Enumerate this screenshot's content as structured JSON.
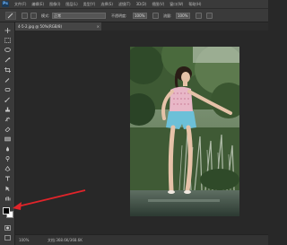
{
  "app": {
    "logo": "Ps"
  },
  "menubar": {
    "items": [
      "文件(F)",
      "编辑(E)",
      "图像(I)",
      "图层(L)",
      "类型(Y)",
      "选择(S)",
      "滤镜(T)",
      "3D(D)",
      "视图(V)",
      "窗口(W)",
      "帮助(H)"
    ]
  },
  "options": {
    "mode_label": "模式:",
    "mode_value": "正常",
    "opacity_label": "不透明度:",
    "opacity_value": "100%",
    "flow_label": "流量:",
    "flow_value": "100%"
  },
  "document": {
    "tab_title": "4-5-2.jpg @ 50%(RGB/8)",
    "close_glyph": "×"
  },
  "status": {
    "zoom": "100%",
    "doc_info": "文档:368.6K/368.6K"
  },
  "colors": {
    "accent": "#6fb6ff",
    "annotation_arrow": "#e0242a"
  }
}
